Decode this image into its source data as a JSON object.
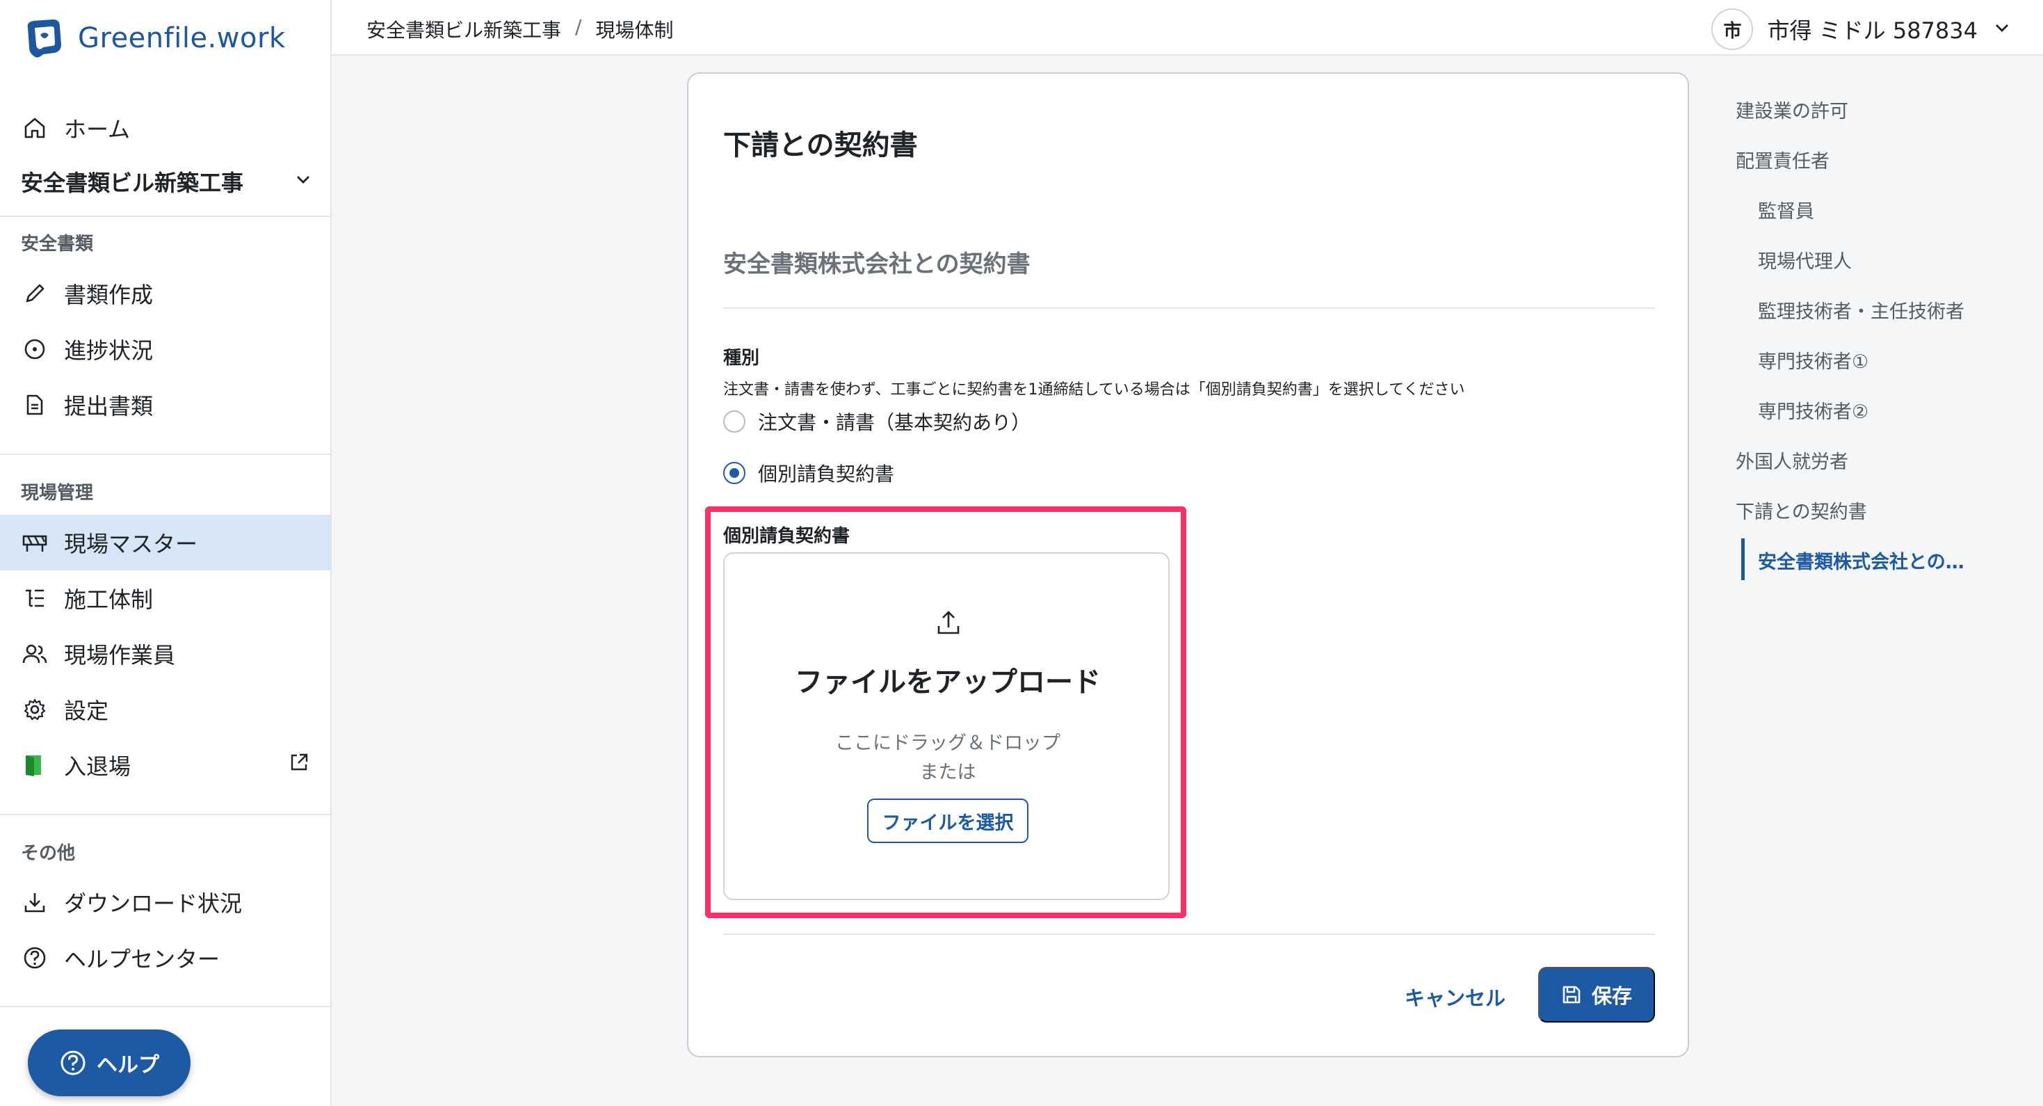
{
  "app": {
    "logo_text": "Greenfile.work"
  },
  "sidebar": {
    "home_label": "ホーム",
    "project_name": "安全書類ビル新築工事",
    "section_safety": "安全書類",
    "items_safety": [
      {
        "label": "書類作成",
        "icon": "pencil-icon"
      },
      {
        "label": "進捗状況",
        "icon": "progress-circle-icon"
      },
      {
        "label": "提出書類",
        "icon": "document-icon"
      }
    ],
    "section_site": "現場管理",
    "items_site": [
      {
        "label": "現場マスター",
        "icon": "barrier-icon",
        "active": true
      },
      {
        "label": "施工体制",
        "icon": "hierarchy-icon"
      },
      {
        "label": "現場作業員",
        "icon": "users-icon"
      },
      {
        "label": "設定",
        "icon": "gear-icon"
      },
      {
        "label": "入退場",
        "icon": "door-icon"
      }
    ],
    "section_other": "その他",
    "items_other": [
      {
        "label": "ダウンロード状況",
        "icon": "download-icon"
      },
      {
        "label": "ヘルプセンター",
        "icon": "help-circle-icon"
      }
    ],
    "help_button_label": "ヘルプ"
  },
  "header": {
    "breadcrumb": [
      "安全書類ビル新築工事",
      "現場体制"
    ],
    "breadcrumb_separator": "/",
    "user_initial": "市",
    "user_name": "市得 ミドル 587834"
  },
  "form": {
    "title": "下請との契約書",
    "subtitle": "安全書類株式会社との契約書",
    "type_label": "種別",
    "type_help": "注文書・請書を使わず、工事ごとに契約書を1通締結している場合は「個別請負契約書」を選択してください",
    "options": [
      {
        "label": "注文書・請書（基本契約あり）",
        "checked": false
      },
      {
        "label": "個別請負契約書",
        "checked": true
      }
    ],
    "upload": {
      "label": "個別請負契約書",
      "title": "ファイルをアップロード",
      "hint_line1": "ここにドラッグ＆ドロップ",
      "hint_line2": "または",
      "select_button": "ファイルを選択"
    },
    "cancel_label": "キャンセル",
    "save_label": "保存"
  },
  "toc": {
    "items": [
      {
        "label": "建設業の許可",
        "level": 0
      },
      {
        "label": "配置責任者",
        "level": 0
      },
      {
        "label": "監督員",
        "level": 1
      },
      {
        "label": "現場代理人",
        "level": 1
      },
      {
        "label": "監理技術者・主任技術者",
        "level": 1
      },
      {
        "label": "専門技術者①",
        "level": 1
      },
      {
        "label": "専門技術者②",
        "level": 1
      },
      {
        "label": "外国人就労者",
        "level": 0
      },
      {
        "label": "下請との契約書",
        "level": 0
      },
      {
        "label": "安全書類株式会社との…",
        "level": 1,
        "active": true
      }
    ]
  },
  "colors": {
    "accent": "#1d5aa3",
    "highlight_border": "#f5336a",
    "active_nav_bg": "#d6e6f7"
  }
}
